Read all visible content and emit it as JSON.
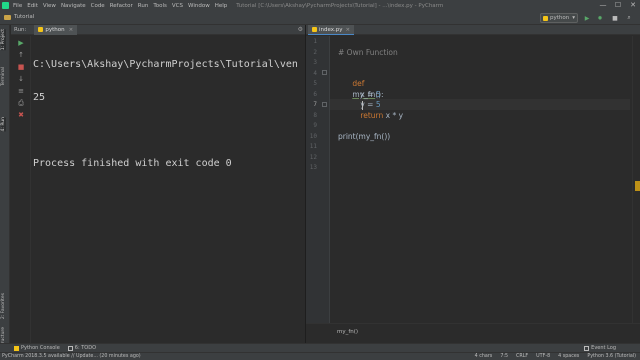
{
  "menubar": {
    "items": [
      "File",
      "Edit",
      "View",
      "Navigate",
      "Code",
      "Refactor",
      "Run",
      "Tools",
      "VCS",
      "Window",
      "Help"
    ],
    "window_title": "Tutorial [C:\\Users\\Akshay\\PycharmProjects\\Tutorial] - ...\\index.py - PyCharm",
    "minimize": "—",
    "maximize": "☐",
    "close": "✕"
  },
  "navbar": {
    "project": "Tutorial",
    "run_config": "python",
    "run_icon": "play-icon",
    "debug_icon": "bug-icon",
    "search_icon": "search-icon"
  },
  "left_gutter": {
    "tabs": [
      "1: Project",
      "Z: Structure",
      "Z: Favorites",
      "2: Structure"
    ],
    "project_label": "1: Project",
    "structure_label": "7: Structure",
    "favorites_label": "2: Favorites",
    "zstructure_label": "Z: Structure",
    "terminal_label": "Terminal",
    "run_label": "4: Run"
  },
  "run_panel": {
    "title": "Run:",
    "tab_label": "python",
    "tab_close": "×",
    "settings": "⚙",
    "console_lines": [
      "C:\\Users\\Akshay\\PycharmProjects\\Tutorial\\ven",
      "25",
      "",
      "Process finished with exit code 0"
    ]
  },
  "editor": {
    "tab_label": "index.py",
    "tab_close": "×",
    "line_numbers": [
      "1",
      "2",
      "3",
      "4",
      "5",
      "6",
      "7",
      "8",
      "9",
      "10",
      "11",
      "12",
      "13"
    ],
    "current_line": 7,
    "code": {
      "l2_comment": "# Own Function",
      "l4_def": "def",
      "l4_name": "my_fn",
      "l4_rest": "():",
      "l5_var": "x = ",
      "l5_num": "5",
      "l6_var": "y = ",
      "l6_num": "5",
      "l7_return": "return",
      "l7_rest": " x * y",
      "l10_call": "print(my_fn())"
    },
    "breadcrumb": "my_fn()"
  },
  "bottom_tools": {
    "python_console": "Python Console",
    "todo": "6: TODO",
    "event_log": "Event Log"
  },
  "statusbar": {
    "message": "PyCharm 2018.3.5 available // Update... (20 minutes ago)",
    "chars": "4 chars",
    "position": "7:5",
    "line_sep": "CRLF",
    "encoding": "UTF-8",
    "indent": "4 spaces",
    "interpreter": "Python 3.6 (Tutorial)"
  }
}
